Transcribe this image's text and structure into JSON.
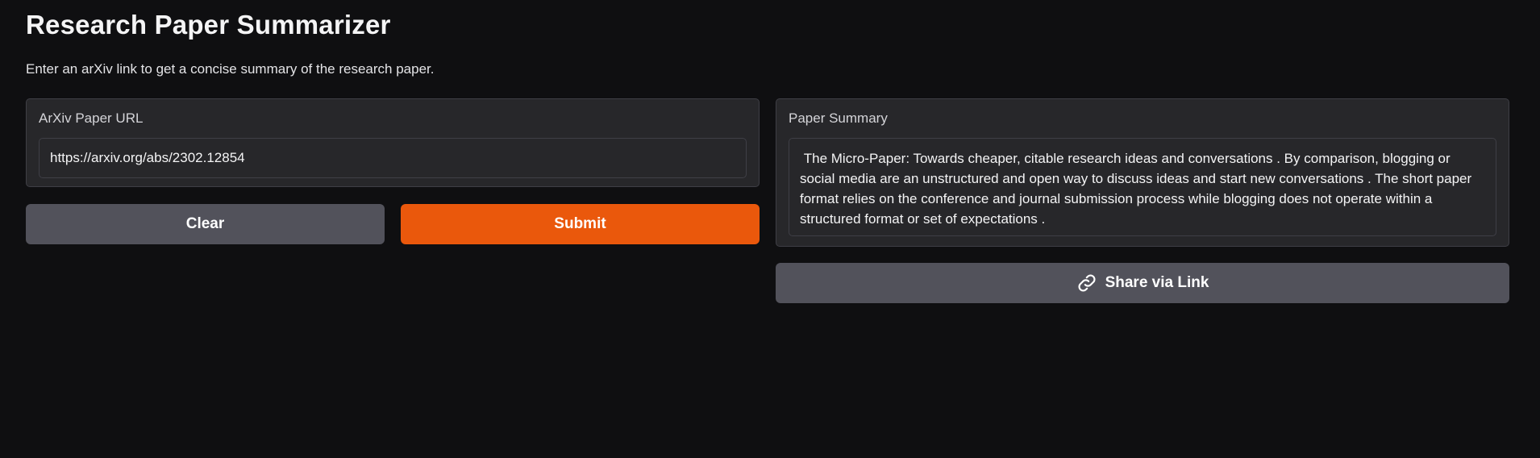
{
  "page": {
    "title": "Research Paper Summarizer",
    "subtitle": "Enter an arXiv link to get a concise summary of the research paper."
  },
  "input_panel": {
    "label": "ArXiv Paper URL",
    "url_value": "https://arxiv.org/abs/2302.12854"
  },
  "actions": {
    "clear_label": "Clear",
    "submit_label": "Submit",
    "share_label": "Share via Link",
    "share_icon": "link-icon"
  },
  "output_panel": {
    "label": "Paper Summary",
    "summary_text": " The Micro-Paper: Towards cheaper, citable research ideas and conversations . By comparison, blogging or social media are an unstructured and open way to discuss ideas and start new conversations . The short paper format relies on the conference and journal submission process while blogging does not operate within a structured format or set of expectations ."
  },
  "colors": {
    "background": "#0f0f11",
    "panel": "#27272a",
    "border": "#3f3f46",
    "secondary_button": "#52525b",
    "primary_button": "#ea580c"
  }
}
